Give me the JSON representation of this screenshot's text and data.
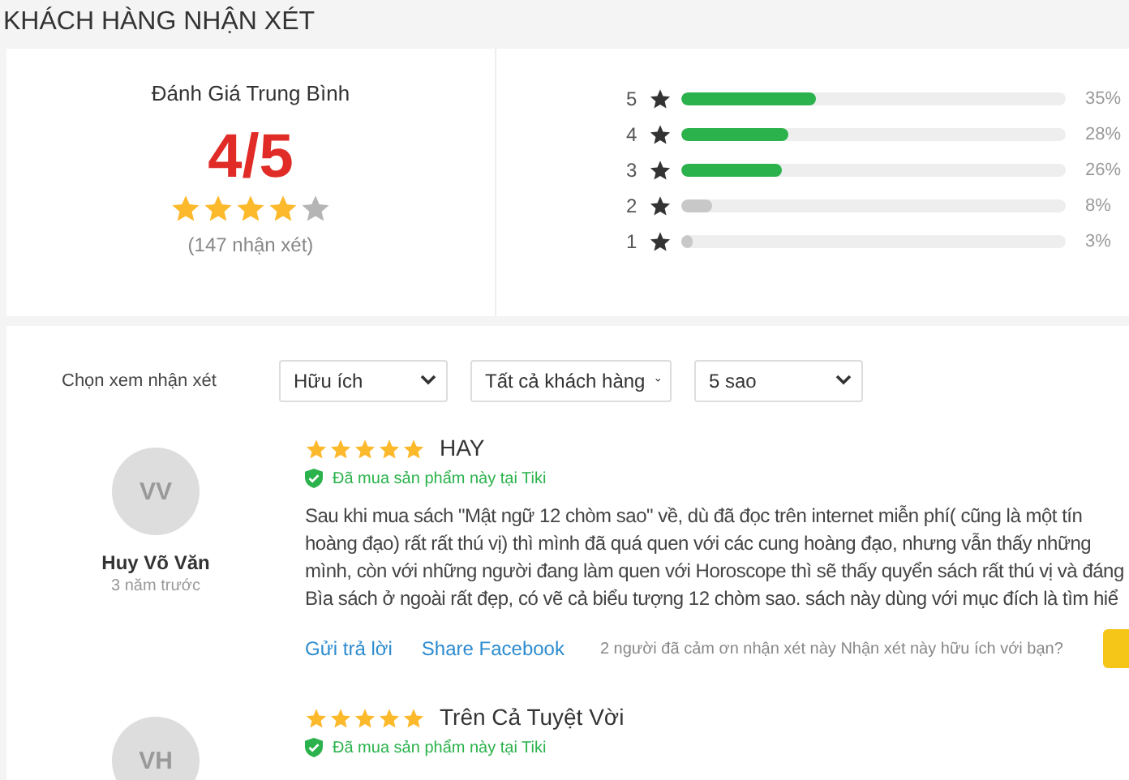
{
  "heading": "KHÁCH HÀNG NHẬN XÉT",
  "summary": {
    "title": "Đánh Giá Trung Bình",
    "score": "4/5",
    "stars": 4,
    "count": "(147 nhận xét)"
  },
  "breakdown": [
    {
      "label": "5",
      "level": 0.35,
      "percent": "35%",
      "color": "#2bb24c"
    },
    {
      "label": "4",
      "level": 0.28,
      "percent": "28%",
      "color": "#2bb24c"
    },
    {
      "label": "3",
      "level": 0.26,
      "percent": "26%",
      "color": "#2bb24c"
    },
    {
      "label": "2",
      "level": 0.08,
      "percent": "8%",
      "color": "#c8c8c8"
    },
    {
      "label": "1",
      "level": 0.03,
      "percent": "3%",
      "color": "#c8c8c8"
    }
  ],
  "filter": {
    "label": "Chọn xem nhận xét",
    "dropdowns": [
      "Hữu ích",
      "Tất cả khách hàng",
      "5 sao"
    ]
  },
  "reviews": [
    {
      "initials": "VV",
      "name": "Huy Võ Văn",
      "time": "3 năm trước",
      "stars": 5,
      "title": "HAY",
      "verified": "Đã mua sản phẩm này tại Tiki",
      "body": [
        "Sau khi mua sách \"Mật ngữ 12 chòm sao\" về, dù đã đọc trên internet miễn phí( cũng là một tín",
        "hoàng đạo) rất rất thú vị) thì mình đã quá quen với các cung hoàng đạo, nhưng vẫn thấy những",
        "mình, còn với những người đang làm quen với Horoscope thì sẽ thấy quyển sách rất thú vị và đáng",
        "Bìa sách ở ngoài rất đẹp, có vẽ cả biểu tượng 12 chòm sao. sách này dùng với mục đích là tìm hiể"
      ],
      "reply": "Gửi trả lời",
      "share": "Share Facebook",
      "thanks": "2 người đã cảm ơn nhận xét này Nhận xét này hữu ích với bạn?"
    },
    {
      "initials": "VH",
      "stars": 5,
      "title": "Trên Cả Tuyệt Vời",
      "verified": "Đã mua sản phẩm này tại Tiki"
    }
  ]
}
